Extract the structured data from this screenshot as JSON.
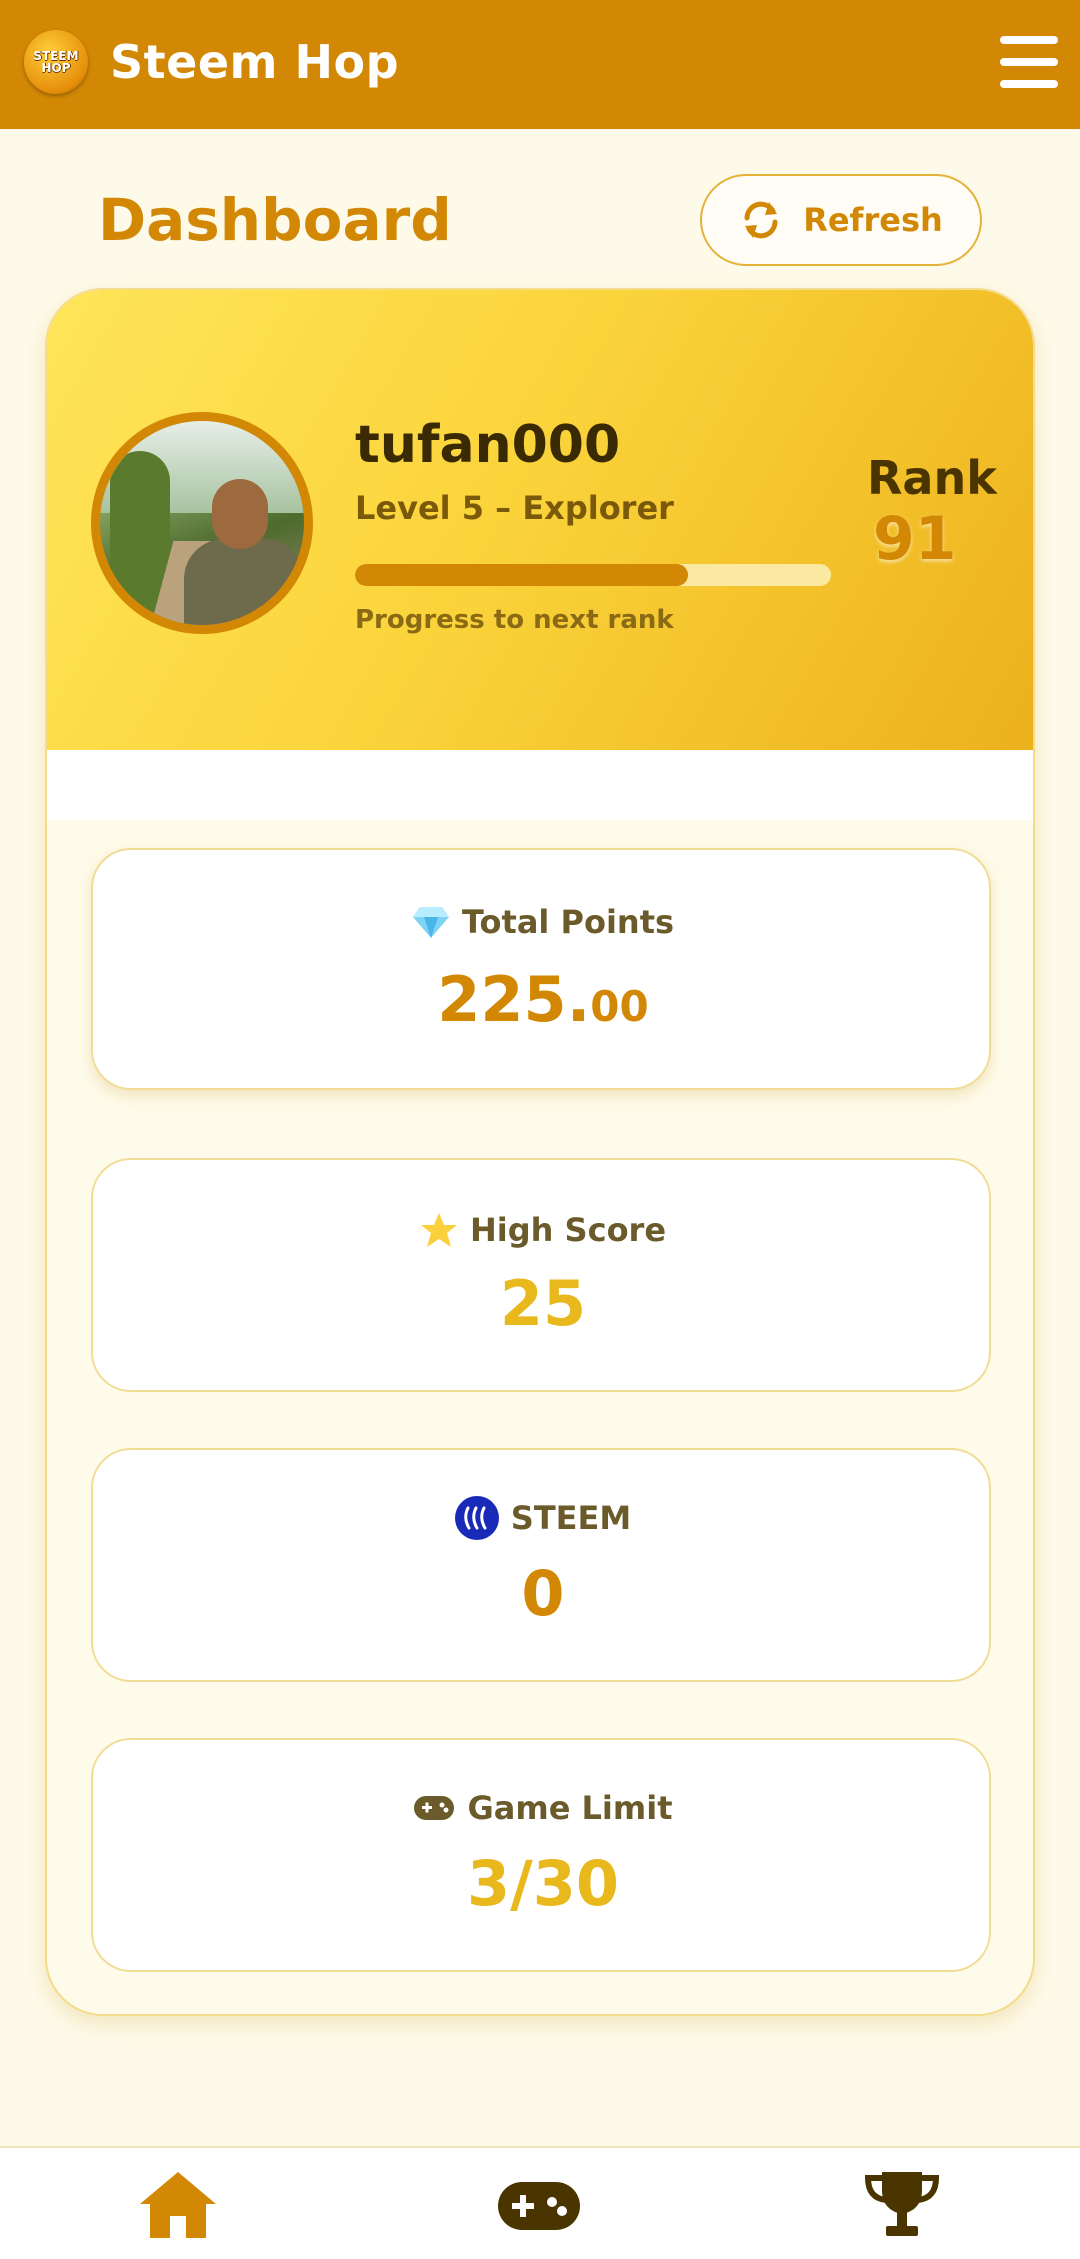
{
  "header": {
    "app_title": "Steem Hop",
    "logo_text": "STEEM HOP",
    "menu_icon": "hamburger-menu-icon"
  },
  "page": {
    "title": "Dashboard",
    "refresh_label": "Refresh",
    "refresh_icon": "refresh-icon"
  },
  "profile": {
    "username": "tufan000",
    "level": "Level 5 – Explorer",
    "progress_fraction": 0.7,
    "progress_label": "Progress to next rank",
    "rank_label": "Rank",
    "rank_value": "91"
  },
  "stats": {
    "total_points": {
      "label": "Total Points",
      "icon": "gem-icon",
      "value_int": "225.",
      "value_dec": "00"
    },
    "high_score": {
      "label": "High Score",
      "icon": "star-icon",
      "value": "25"
    },
    "steem": {
      "label": "STEEM",
      "icon": "steem-logo-icon",
      "value": "0"
    },
    "game_limit": {
      "label": "Game Limit",
      "icon": "gamepad-icon",
      "value": "3/30"
    }
  },
  "bottom_nav": {
    "items": [
      {
        "icon": "home-icon"
      },
      {
        "icon": "gamepad-icon"
      },
      {
        "icon": "trophy-icon"
      }
    ]
  },
  "colors": {
    "accent": "#d38805",
    "gold": "#e7b41c",
    "background": "#fefae9",
    "steem_blue": "#1a2ab8"
  }
}
